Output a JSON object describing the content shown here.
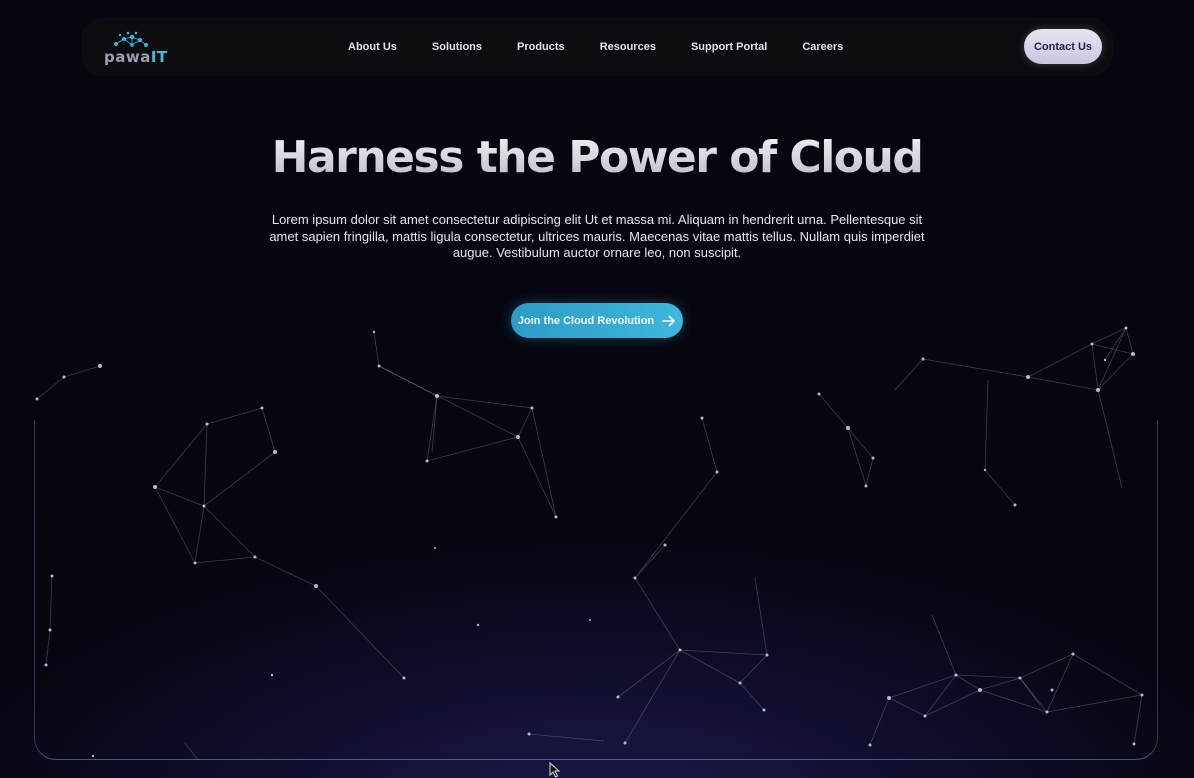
{
  "brand": {
    "logo_text_main": "pawa",
    "logo_text_accent": "IT",
    "accent_color": "#3fb8dc"
  },
  "nav": {
    "items": [
      "About Us",
      "Solutions",
      "Products",
      "Resources",
      "Support Portal",
      "Careers"
    ],
    "contact_label": "Contact Us"
  },
  "hero": {
    "title": "Harness the Power of Cloud",
    "description": "Lorem ipsum dolor sit amet consectetur adipiscing elit Ut et massa mi. Aliquam in hendrerit urna. Pellentesque sit amet sapien fringilla, mattis ligula consectetur, ultrices mauris. Maecenas vitae mattis tellus. Nullam quis imperdiet augue. Vestibulum auctor ornare leo, non suscipit.",
    "cta_label": "Join the Cloud Revolution",
    "cta_icon": "arrow-right-icon"
  },
  "background": {
    "decoration": "constellation-network"
  }
}
